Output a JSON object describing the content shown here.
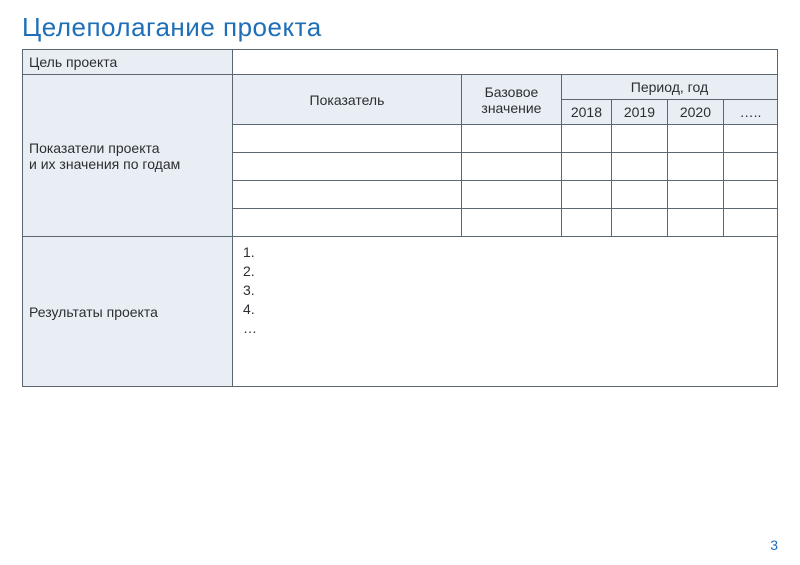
{
  "title": "Целеполагание проекта",
  "labels": {
    "goal": "Цель проекта",
    "indicators": "Показатели проекта\nи их значения по годам",
    "indicator_col": "Показатель",
    "base_value": "Базовое значение",
    "period": "Период, год",
    "results": "Результаты проекта"
  },
  "years": [
    "2018",
    "2019",
    "2020",
    "….."
  ],
  "goal_value": "",
  "chart_data": {
    "type": "table",
    "title": "Показатели проекта и их значения по годам",
    "columns": [
      "Показатель",
      "Базовое значение",
      "2018",
      "2019",
      "2020",
      "….."
    ],
    "rows": [
      [
        "",
        "",
        "",
        "",
        "",
        ""
      ],
      [
        "",
        "",
        "",
        "",
        "",
        ""
      ],
      [
        "",
        "",
        "",
        "",
        "",
        ""
      ],
      [
        "",
        "",
        "",
        "",
        "",
        ""
      ]
    ]
  },
  "results_list": [
    "1.",
    "2.",
    "3.",
    "4.",
    "…"
  ],
  "page_number": "3"
}
